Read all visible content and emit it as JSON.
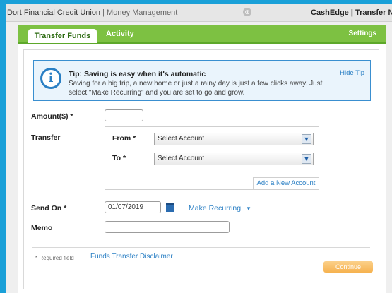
{
  "browser": {
    "site_name": "Dort Financial Credit Union",
    "separator": " | ",
    "page_name": "Money Management",
    "tab_close_glyph": "⊗",
    "other_tab_title": "CashEdge | Transfer NOW"
  },
  "nav": {
    "active_tab": "Transfer Funds",
    "tab_activity": "Activity",
    "settings": "Settings"
  },
  "tip": {
    "title": "Tip: Saving is easy when it's automatic",
    "body": "Saving for a big trip, a new home or just a rainy day is just a few clicks away. Just select \"Make Recurring\" and you are set to go and grow.",
    "hide": "Hide Tip",
    "icon": "info-icon"
  },
  "form": {
    "amount_label": "Amount($) *",
    "amount_value": "",
    "transfer_label": "Transfer",
    "from_label": "From *",
    "from_value": "Select Account",
    "to_label": "To *",
    "to_value": "Select Account",
    "add_account": "Add a New Account",
    "send_on_label": "Send On *",
    "send_on_value": "01/07/2019",
    "make_recurring": "Make Recurring",
    "make_recurring_arrow": "▼",
    "memo_label": "Memo",
    "memo_value": ""
  },
  "footer": {
    "required_note": "* Required field",
    "disclaimer": "Funds Transfer Disclaimer",
    "continue": "Continue"
  },
  "colors": {
    "nav_green": "#7dc142",
    "link_blue": "#2a7fc4",
    "continue_orange": "#f6b24f",
    "frame_blue": "#1aa0d8"
  }
}
